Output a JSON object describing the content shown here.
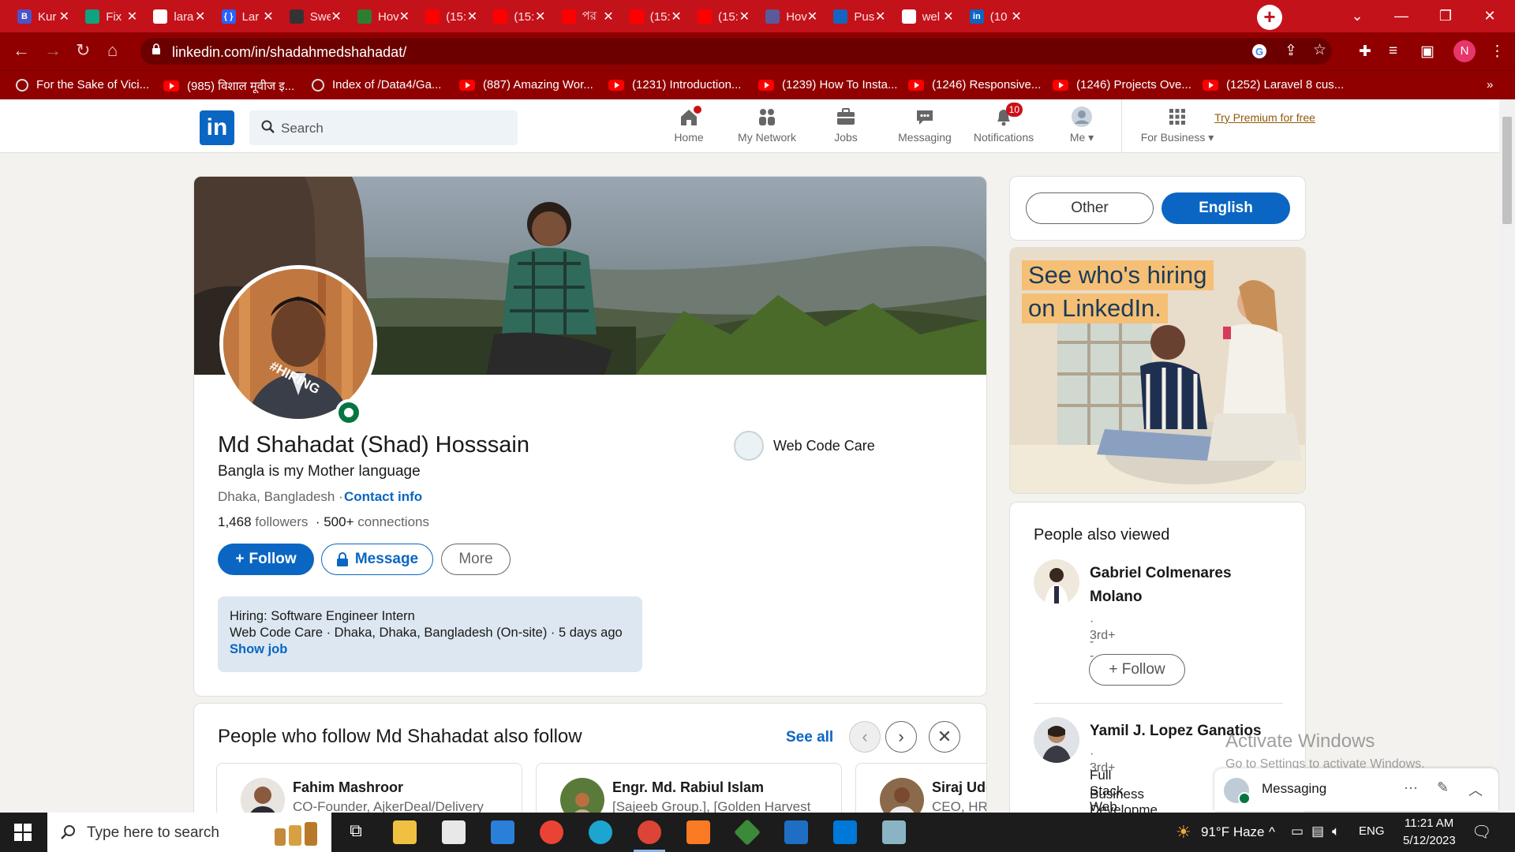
{
  "browser": {
    "tabs": [
      {
        "title": "Kur",
        "favicon": "B",
        "color": "#4a54c8"
      },
      {
        "title": "Fix",
        "favicon": "chatgpt-icon",
        "color": "#10a37f"
      },
      {
        "title": "lara",
        "favicon": "google-icon",
        "color": "#ffffff"
      },
      {
        "title": "Lar",
        "favicon": "{ }",
        "color": "#2962ff"
      },
      {
        "title": "Swe",
        "favicon": "circle-icon",
        "color": "#333333"
      },
      {
        "title": "Hov",
        "favicon": "leaf-icon",
        "color": "#2e7d32"
      },
      {
        "title": "(15:",
        "favicon": "youtube-icon",
        "color": "#ff0000"
      },
      {
        "title": "(15:",
        "favicon": "youtube-icon",
        "color": "#ff0000"
      },
      {
        "title": "পর",
        "favicon": "youtube-icon",
        "color": "#ff0000"
      },
      {
        "title": "(15:",
        "favicon": "youtube-icon",
        "color": "#ff0000"
      },
      {
        "title": "(15:",
        "favicon": "youtube-icon",
        "color": "#ff0000"
      },
      {
        "title": "Hov",
        "favicon": "feather-icon",
        "color": "#5a5a9a"
      },
      {
        "title": "Pus",
        "favicon": "doc-icon",
        "color": "#1565c0"
      },
      {
        "title": "wel",
        "favicon": "google-icon",
        "color": "#ffffff"
      },
      {
        "title": "(10",
        "favicon": "in",
        "color": "#0a66c2"
      }
    ],
    "url": "linkedin.com/in/shadahmedshahadat/",
    "profile_initial": "N",
    "bookmarks": [
      {
        "label": "For the Sake of Vici...",
        "icon": "globe-icon"
      },
      {
        "label": "(985) विशाल मूवीज इ...",
        "icon": "youtube-icon"
      },
      {
        "label": "Index of /Data4/Ga...",
        "icon": "globe-icon"
      },
      {
        "label": "(887) Amazing Wor...",
        "icon": "youtube-icon"
      },
      {
        "label": "(1231) Introduction...",
        "icon": "youtube-icon"
      },
      {
        "label": "(1239) How To Insta...",
        "icon": "youtube-icon"
      },
      {
        "label": "(1246) Responsive...",
        "icon": "youtube-icon"
      },
      {
        "label": "(1246) Projects Ove...",
        "icon": "youtube-icon"
      },
      {
        "label": "(1252) Laravel 8 cus...",
        "icon": "youtube-icon"
      }
    ],
    "more_bookmarks": "»"
  },
  "linkedin_nav": {
    "logo": "in",
    "search_placeholder": "Search",
    "items": [
      {
        "label": "Home",
        "icon": "home-icon"
      },
      {
        "label": "My Network",
        "icon": "network-icon"
      },
      {
        "label": "Jobs",
        "icon": "briefcase-icon"
      },
      {
        "label": "Messaging",
        "icon": "chat-icon"
      },
      {
        "label": "Notifications",
        "icon": "bell-icon",
        "badge": "10"
      },
      {
        "label": "Me",
        "icon": "avatar-icon"
      },
      {
        "label": "For Business",
        "icon": "grid-icon"
      }
    ],
    "premium": "Try Premium for free"
  },
  "profile": {
    "badge": "#HIRING",
    "name": "Md Shahadat (Shad) Hosssain",
    "headline": "Bangla is my Mother language",
    "location": "Dhaka, Bangladesh",
    "location_sep": "·",
    "contact_info": "Contact info",
    "followers_count": "1,468",
    "followers_label": "followers",
    "connections_count": "· 500+",
    "connections_label": "connections",
    "company": "Web Code Care",
    "buttons": {
      "follow": "Follow",
      "message": "Message",
      "more": "More"
    },
    "hiring": {
      "title": "Hiring: Software Engineer Intern",
      "detail": "Web Code Care · Dhaka, Dhaka, Bangladesh (On-site) · 5 days ago",
      "link": "Show job"
    }
  },
  "also_follow": {
    "title": "People who follow Md Shahadat also follow",
    "see_all": "See all",
    "people": [
      {
        "name": "Fahim Mashroor",
        "desc": "CO-Founder, AjkerDeal/Delivery"
      },
      {
        "name": "Engr. Md. Rabiul Islam",
        "desc": "[Sajeeb Group.], [Golden Harvest"
      },
      {
        "name": "Siraj Udd",
        "desc": "CEO, HR"
      }
    ]
  },
  "language": {
    "other": "Other",
    "english": "English"
  },
  "ad": {
    "line1": "See who's hiring",
    "line2": "on LinkedIn."
  },
  "people_also_viewed": {
    "title": "People also viewed",
    "people": [
      {
        "name": "Gabriel Colmenares Molano",
        "degree": "· 3rd+",
        "headline": "--",
        "follow": "Follow"
      },
      {
        "name": "Yamil J. Lopez Ganatios",
        "degree": "· 3rd+",
        "headline": "Full Stack Web Devel",
        "headline2": "Business Developme"
      }
    ]
  },
  "messaging_popup": {
    "label": "Messaging"
  },
  "activate": {
    "line1": "Activate Windows",
    "line2": "Go to Settings to activate Windows."
  },
  "taskbar": {
    "search": "Type here to search",
    "weather": "91°F  Haze",
    "lang": "ENG",
    "time": "11:21 AM",
    "date": "5/12/2023"
  }
}
